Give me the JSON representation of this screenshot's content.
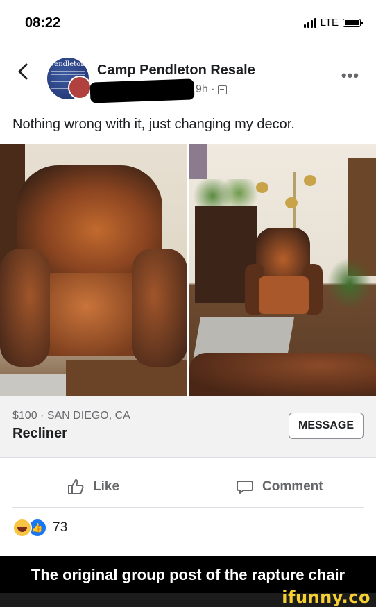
{
  "status_bar": {
    "time": "08:22",
    "network": "LTE"
  },
  "post": {
    "group_name": "Camp Pendleton Resale",
    "avatar_text": "Pendleton",
    "time_ago": "9h ·",
    "caption": "Nothing wrong with it, just changing my decor."
  },
  "listing": {
    "price_location": "$100 · SAN DIEGO, CA",
    "title": "Recliner",
    "message_label": "MESSAGE"
  },
  "actions": {
    "like_label": "Like",
    "comment_label": "Comment"
  },
  "reactions": {
    "count": "73",
    "types": [
      "haha",
      "like"
    ]
  },
  "meme": {
    "caption": "The original group post of the rapture chair",
    "watermark": "ifunny.co"
  },
  "colors": {
    "accent": "#1877f2",
    "meta_gray": "#65676b",
    "watermark_yellow": "#f6cf32"
  }
}
